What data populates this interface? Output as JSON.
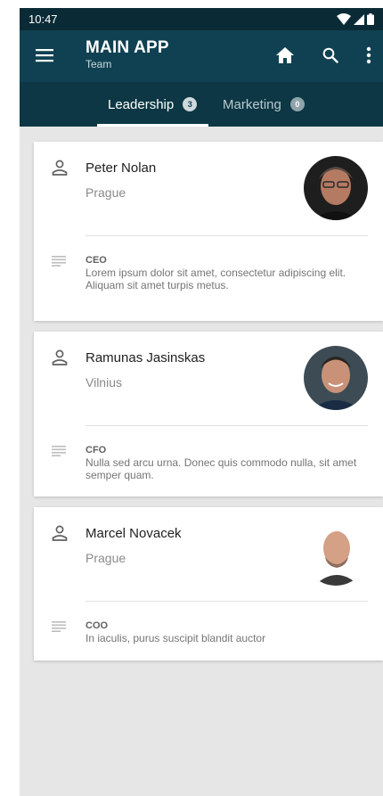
{
  "status_bar": {
    "time": "10:47"
  },
  "app_bar": {
    "title": "MAIN APP",
    "subtitle": "Team"
  },
  "tabs": [
    {
      "label": "Leadership",
      "count": "3",
      "active": true
    },
    {
      "label": "Marketing",
      "count": "0",
      "active": false
    }
  ],
  "people": [
    {
      "name": "Peter Nolan",
      "city": "Prague",
      "role": "CEO",
      "description": "Lorem ipsum dolor sit amet, consectetur adipiscing elit. Aliquam sit amet turpis metus."
    },
    {
      "name": "Ramunas Jasinskas",
      "city": "Vilnius",
      "role": "CFO",
      "description": "Nulla sed arcu urna. Donec quis commodo nulla, sit amet semper quam."
    },
    {
      "name": "Marcel Novacek",
      "city": "Prague",
      "role": "COO",
      "description": "In iaculis, purus suscipit blandit auctor"
    }
  ],
  "colors": {
    "status_bar": "#0a2b36",
    "app_bar": "#104152",
    "tab_bar": "#0d3744",
    "background": "#e6e6e6"
  },
  "icons": [
    "menu-icon",
    "home-icon",
    "search-icon",
    "more-vert-icon",
    "person-icon",
    "notes-icon",
    "wifi-icon",
    "signal-icon",
    "battery-icon"
  ]
}
